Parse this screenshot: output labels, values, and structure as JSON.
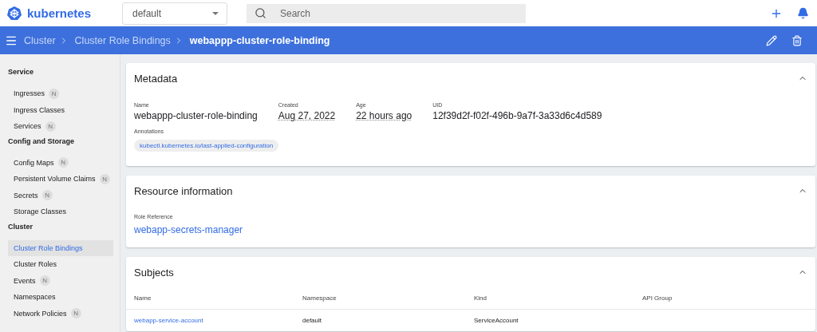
{
  "top_bar": {
    "logo_text": "kubernetes",
    "namespace_select": {
      "value": "default"
    },
    "search": {
      "placeholder": "Search"
    }
  },
  "header": {
    "breadcrumbs": [
      {
        "label": "Cluster",
        "current": false
      },
      {
        "label": "Cluster Role Bindings",
        "current": false
      },
      {
        "label": "webappp-cluster-role-binding",
        "current": true
      }
    ]
  },
  "sidebar": {
    "groups": [
      {
        "title": "Service",
        "items": [
          {
            "label": "Ingresses",
            "badge": "N",
            "selected": false
          },
          {
            "label": "Ingress Classes",
            "selected": false
          },
          {
            "label": "Services",
            "badge": "N",
            "selected": false
          }
        ]
      },
      {
        "title": "Config and Storage",
        "items": [
          {
            "label": "Config Maps",
            "badge": "N",
            "selected": false
          },
          {
            "label": "Persistent Volume Claims",
            "badge": "N",
            "selected": false
          },
          {
            "label": "Secrets",
            "badge": "N",
            "selected": false
          },
          {
            "label": "Storage Classes",
            "selected": false
          }
        ]
      },
      {
        "title": "Cluster",
        "items": [
          {
            "label": "Cluster Role Bindings",
            "selected": true
          },
          {
            "label": "Cluster Roles",
            "selected": false
          },
          {
            "label": "Events",
            "badge": "N",
            "selected": false
          },
          {
            "label": "Namespaces",
            "selected": false
          },
          {
            "label": "Network Policies",
            "badge": "N",
            "selected": false
          }
        ]
      }
    ]
  },
  "metadata": {
    "title": "Metadata",
    "fields": [
      {
        "label": "Name",
        "value": "webappp-cluster-role-binding",
        "kind": "plain"
      },
      {
        "label": "Created",
        "value": "Aug 27, 2022",
        "kind": "dotted"
      },
      {
        "label": "Age",
        "value": "22 hours ago",
        "kind": "dotted"
      },
      {
        "label": "UID",
        "value": "12f39d2f-f02f-496b-9a7f-3a33d6c4d589",
        "kind": "plain"
      }
    ],
    "annotations_label": "Annotations",
    "annotations": [
      "kubectl.kubernetes.io/last-applied-configuration"
    ]
  },
  "resource_information": {
    "title": "Resource information",
    "label": "Role Reference",
    "value": "webapp-secrets-manager"
  },
  "subjects": {
    "title": "Subjects",
    "columns": [
      "Name",
      "Namespace",
      "Kind",
      "API Group"
    ],
    "rows": [
      [
        "webapp-service-account",
        "default",
        "ServiceAccount",
        ""
      ]
    ]
  }
}
